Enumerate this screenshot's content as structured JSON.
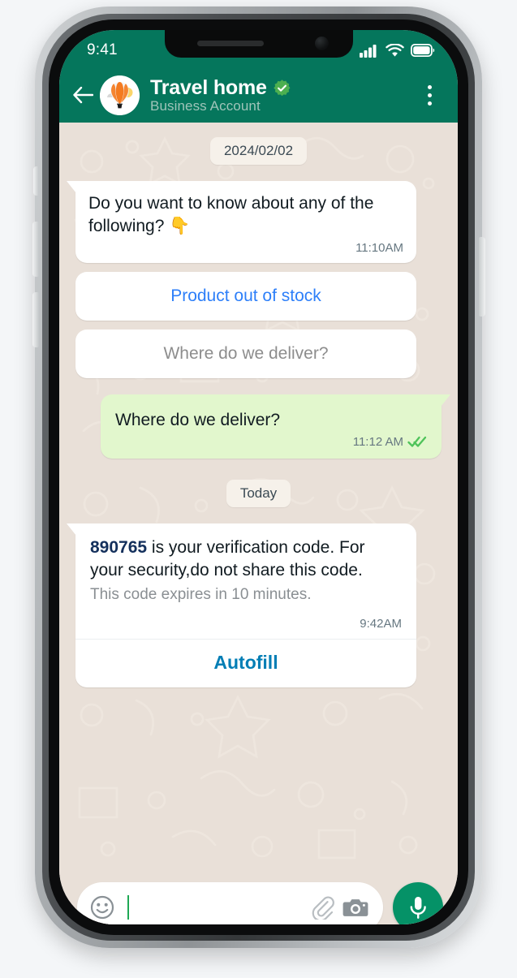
{
  "status_bar": {
    "time": "9:41",
    "icons": [
      "cellular-signal-icon",
      "wifi-icon",
      "battery-icon"
    ]
  },
  "chat_header": {
    "back_icon": "back-arrow-icon",
    "avatar_icon": "hot-air-balloon-avatar",
    "title": "Travel home",
    "verified_badge": "verified-badge-icon",
    "subtitle": "Business Account",
    "menu_icon": "overflow-menu-icon"
  },
  "conversation": {
    "day_divider_1": "2024/02/02",
    "day_divider_2": "Today",
    "message_1": {
      "text": "Do you want to know about any of the following? 👇",
      "time": "11:10AM"
    },
    "quick_reply_1": "Product out of stock",
    "quick_reply_2": "Where do we deliver?",
    "message_2": {
      "text": "Where do we deliver?",
      "time": "11:12 AM",
      "receipt": "read-double-check-icon"
    },
    "verification": {
      "code": "890765",
      "body_rest": " is your verification code. For your security,do not share this code.",
      "expiry": "This code expires in 10 minutes.",
      "time": "9:42AM",
      "autofill_label": "Autofill"
    }
  },
  "composer": {
    "emoji_icon": "emoji-smiley-icon",
    "input_value": "",
    "input_placeholder": "",
    "attach_icon": "paperclip-icon",
    "camera_icon": "camera-icon",
    "mic_icon": "microphone-icon"
  },
  "colors": {
    "header_green": "#05765c",
    "chat_bg": "#e9e0d8",
    "outgoing_bubble": "#e2f7cd",
    "link_blue": "#2d7ff9",
    "autofill_blue": "#027eb5",
    "mic_green": "#059267",
    "code_navy": "#14305c"
  }
}
